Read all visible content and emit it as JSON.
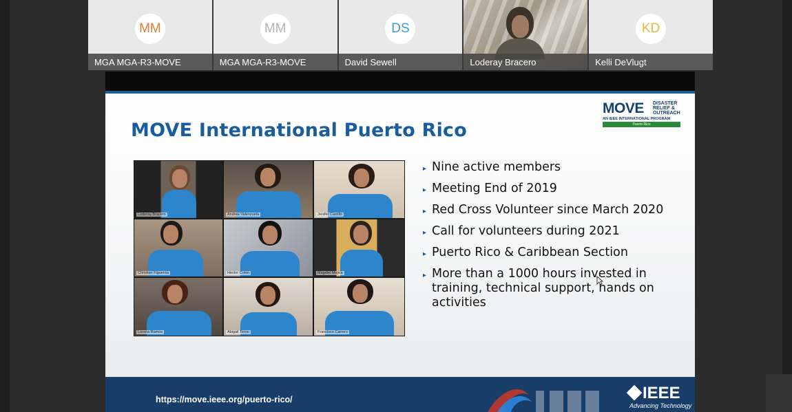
{
  "participants": [
    {
      "initials": "MM",
      "name": "MGA MGA-R3-MOVE",
      "color": "#e07b39",
      "video": false
    },
    {
      "initials": "MM",
      "name": "MGA MGA-R3-MOVE",
      "color": "#b4b4b4",
      "video": false
    },
    {
      "initials": "DS",
      "name": "David Sewell",
      "color": "#3a9bd9",
      "video": false
    },
    {
      "initials": "",
      "name": "Loderay Bracero",
      "color": "",
      "video": true
    },
    {
      "initials": "KD",
      "name": "Kelli DeVlugt",
      "color": "#e6b83a",
      "video": false
    }
  ],
  "slide": {
    "title": "MOVE International Puerto Rico",
    "logo": {
      "word": "MOVE",
      "sub": "DISASTER RELIEF & OUTREACH",
      "program": "AN IEEE INTERNATIONAL PROGRAM",
      "region": "Puerto Rico"
    },
    "photo_grid": [
      {
        "caption": "Loderay Bracero"
      },
      {
        "caption": "Andrea Valenzuela"
      },
      {
        "caption": "Jenifer Castillo"
      },
      {
        "caption": "Christian Figueroa"
      },
      {
        "caption": "Hector Colon"
      },
      {
        "caption": "Magdiel Mojica"
      },
      {
        "caption": "Lorena Ramos"
      },
      {
        "caption": "Abigail Teron"
      },
      {
        "caption": "Francisco Carrero"
      }
    ],
    "bullets": [
      "Nine active members",
      "Meeting End of 2019",
      "Red Cross Volunteer since March 2020",
      "Call for volunteers during 2021",
      "Puerto Rico & Caribbean Section",
      "More than a 1000 hours invested in training, technical support, hands on activities"
    ],
    "footer": {
      "url": "https://move.ieee.org/puerto-rico/",
      "ieee_word": "IEEE",
      "ieee_tagline": "Advancing Technology"
    }
  },
  "colors": {
    "title": "#1a5c9c",
    "footer": "#173d68",
    "shirt": "#2d86cc"
  }
}
